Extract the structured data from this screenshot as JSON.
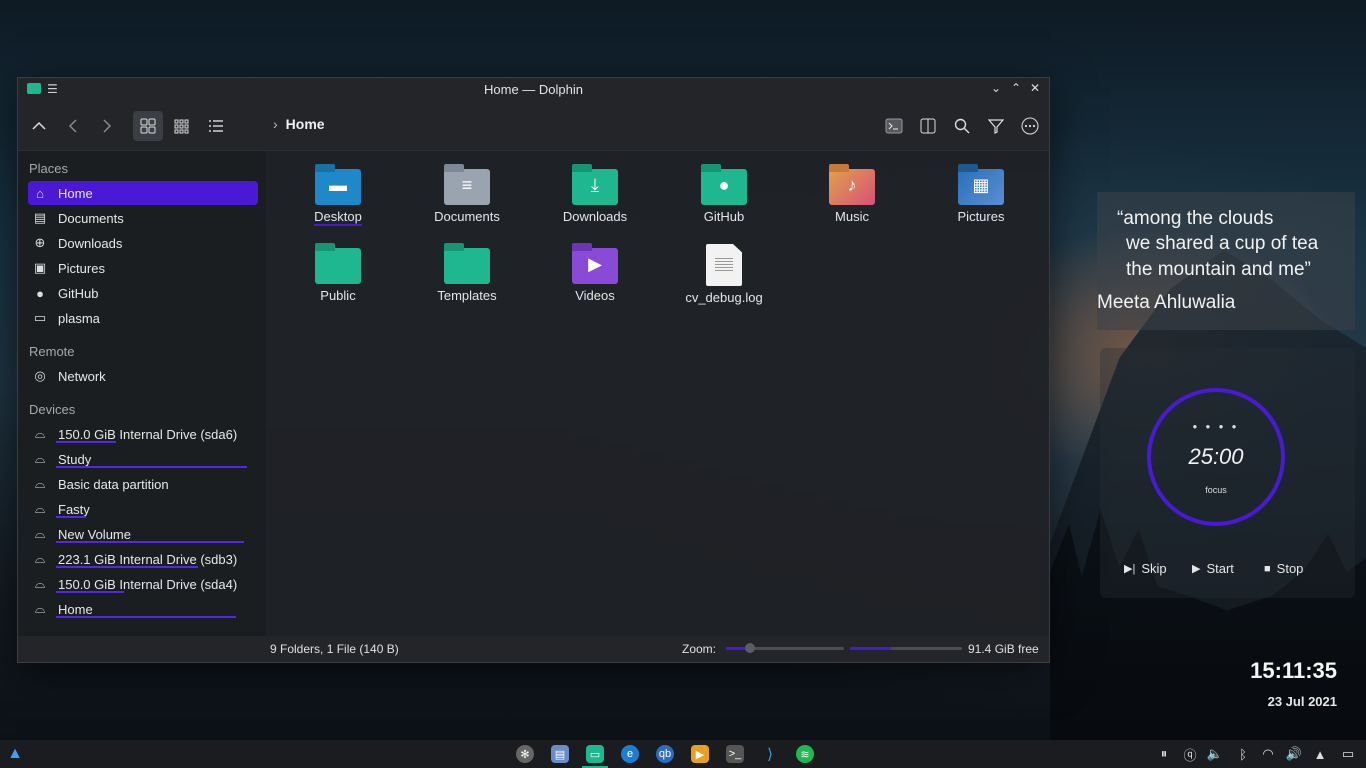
{
  "window": {
    "title": "Home — Dolphin"
  },
  "breadcrumb": {
    "current": "Home"
  },
  "sidebar": {
    "places_heading": "Places",
    "places": [
      {
        "label": "Home",
        "icon": "home-icon"
      },
      {
        "label": "Documents",
        "icon": "documents-icon"
      },
      {
        "label": "Downloads",
        "icon": "downloads-icon"
      },
      {
        "label": "Pictures",
        "icon": "pictures-icon"
      },
      {
        "label": "GitHub",
        "icon": "github-icon"
      },
      {
        "label": "plasma",
        "icon": "folder-icon"
      }
    ],
    "remote_heading": "Remote",
    "remote": [
      {
        "label": "Network",
        "icon": "network-icon"
      }
    ],
    "devices_heading": "Devices",
    "devices": [
      {
        "label": "150.0 GiB Internal Drive (sda6)"
      },
      {
        "label": "Study"
      },
      {
        "label": "Basic data partition"
      },
      {
        "label": "Fasty"
      },
      {
        "label": "New Volume"
      },
      {
        "label": "223.1 GiB Internal Drive (sdb3)"
      },
      {
        "label": "150.0 GiB Internal Drive (sda4)"
      },
      {
        "label": "Home"
      }
    ]
  },
  "files": [
    {
      "name": "Desktop",
      "icon": "desktop-folder-icon",
      "color": "#1e88c8"
    },
    {
      "name": "Documents",
      "icon": "documents-folder-icon",
      "color": "#9aa4b0"
    },
    {
      "name": "Downloads",
      "icon": "downloads-folder-icon",
      "color": "#1fb78f"
    },
    {
      "name": "GitHub",
      "icon": "github-folder-icon",
      "color": "#1fb78f"
    },
    {
      "name": "Music",
      "icon": "music-folder-icon",
      "color": "#e07a4a"
    },
    {
      "name": "Pictures",
      "icon": "pictures-folder-icon",
      "color": "#2a6fb8"
    },
    {
      "name": "Public",
      "icon": "public-folder-icon",
      "color": "#1fb78f"
    },
    {
      "name": "Templates",
      "icon": "templates-folder-icon",
      "color": "#1fb78f"
    },
    {
      "name": "Videos",
      "icon": "videos-folder-icon",
      "color": "#8a4ad8"
    },
    {
      "name": "cv_debug.log",
      "icon": "text-file-icon",
      "color": "#f2f2f2"
    }
  ],
  "status": {
    "summary": "9 Folders, 1 File (140 B)",
    "zoom_label": "Zoom:",
    "zoom_level": 0.2,
    "space_used_fraction": 0.37,
    "free_space": "91.4 GiB free"
  },
  "quote": {
    "lines": [
      "“among the clouds",
      "we shared a cup of tea",
      "the mountain and me”"
    ],
    "author": "Meeta Ahluwalia"
  },
  "timer": {
    "time": "25:00",
    "mode": "focus",
    "skip": "Skip",
    "start": "Start",
    "stop": "Stop"
  },
  "clock": {
    "time": "15:11:35",
    "date": "23 Jul 2021"
  },
  "colors": {
    "accent": "#4a19d6",
    "teal": "#1fb78f"
  }
}
